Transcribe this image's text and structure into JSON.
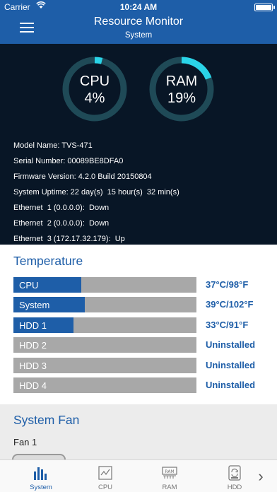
{
  "status_bar": {
    "carrier": "Carrier",
    "time": "10:24 AM"
  },
  "header": {
    "title": "Resource Monitor",
    "subtitle": "System"
  },
  "gauges": {
    "cpu": {
      "label": "CPU",
      "value": "4%",
      "percent": 4
    },
    "ram": {
      "label": "RAM",
      "value": "19%",
      "percent": 19
    }
  },
  "colors": {
    "accent": "#1e5ea8",
    "gauge_track": "#1f4a57",
    "gauge_fill": "#2ad4e8",
    "panel": "#081626"
  },
  "system_info": [
    "Model Name: TVS-471",
    "Serial Number: 00089BE8DFA0",
    "Firmware Version: 4.2.0 Build 20150804",
    "System Uptime: 22 day(s)  15 hour(s)  32 min(s)",
    "Ethernet  1 (0.0.0.0):  Down",
    "Ethernet  2 (0.0.0.0):  Down",
    "Ethernet  3 (172.17.32.179):  Up"
  ],
  "temperature": {
    "title": "Temperature",
    "rows": [
      {
        "label": "CPU",
        "value": "37°C/98°F",
        "fill_fraction": 0.37
      },
      {
        "label": "System",
        "value": "39°C/102°F",
        "fill_fraction": 0.39
      },
      {
        "label": "HDD 1",
        "value": "33°C/91°F",
        "fill_fraction": 0.33
      },
      {
        "label": "HDD 2",
        "value": "Uninstalled",
        "fill_fraction": 0
      },
      {
        "label": "HDD 3",
        "value": "Uninstalled",
        "fill_fraction": 0
      },
      {
        "label": "HDD 4",
        "value": "Uninstalled",
        "fill_fraction": 0
      }
    ]
  },
  "fan": {
    "title": "System Fan",
    "items": [
      "Fan  1"
    ]
  },
  "tabs": [
    {
      "label": "System",
      "icon": "bar-chart-icon",
      "active": true
    },
    {
      "label": "CPU",
      "icon": "cpu-chip-icon",
      "active": false
    },
    {
      "label": "RAM",
      "icon": "ram-module-icon",
      "active": false
    },
    {
      "label": "HDD",
      "icon": "hard-drive-icon",
      "active": false
    }
  ]
}
